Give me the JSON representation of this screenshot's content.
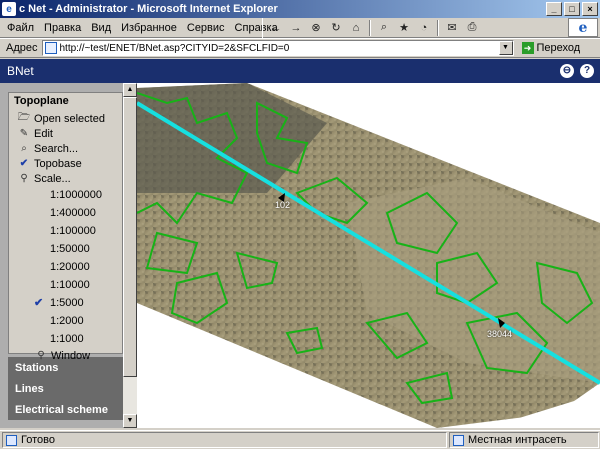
{
  "window": {
    "title": "c Net - Administrator - Microsoft Internet Explorer"
  },
  "menu": {
    "items": [
      "Файл",
      "Правка",
      "Вид",
      "Избранное",
      "Сервис",
      "Справка"
    ]
  },
  "toolbar": {
    "icons": [
      "back-icon",
      "forward-icon",
      "stop-icon",
      "refresh-icon",
      "home-icon",
      "search-icon",
      "favorites-icon",
      "history-icon",
      "mail-icon",
      "print-icon"
    ]
  },
  "address": {
    "label": "Адрес",
    "url": "http://~test/ENET/BNet.asp?CITYID=2&SFCLFID=0",
    "go_label": "Переход"
  },
  "app": {
    "title": "BNet"
  },
  "sidebar": {
    "topoplane": {
      "title": "Topoplane",
      "open_selected": "Open selected",
      "edit": "Edit",
      "search": "Search...",
      "topobase": "Topobase",
      "scale": "Scale...",
      "scales": [
        "1:1000000",
        "1:400000",
        "1:100000",
        "1:50000",
        "1:20000",
        "1:10000",
        "1:5000",
        "1:2000",
        "1:1000"
      ],
      "selected_scale": "1:5000",
      "window": "Window"
    },
    "panels": [
      "Stations",
      "Lines",
      "Electrical scheme"
    ]
  },
  "map": {
    "labels": [
      {
        "id": "marker-1",
        "text": "102"
      },
      {
        "id": "marker-2",
        "text": "38044"
      }
    ]
  },
  "status": {
    "text": "Готово",
    "zone": "Местная интрасеть"
  }
}
